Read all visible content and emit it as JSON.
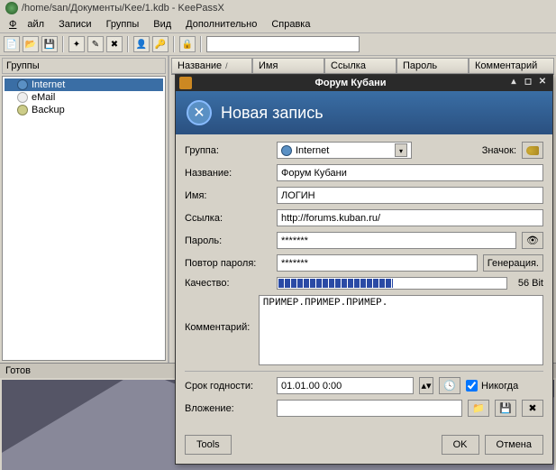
{
  "window": {
    "title": "/home/san/Документы/Kee/1.kdb - KeePassX"
  },
  "menu": {
    "file": "Файл",
    "entries": "Записи",
    "groups": "Группы",
    "view": "Вид",
    "extras": "Дополнительно",
    "help": "Справка"
  },
  "sidebar": {
    "title": "Группы",
    "items": [
      {
        "label": "Internet"
      },
      {
        "label": "eMail"
      },
      {
        "label": "Backup"
      }
    ]
  },
  "columns": {
    "title": "Название",
    "user": "Имя",
    "url": "Ссылка",
    "pwd": "Пароль",
    "comment": "Комментарий"
  },
  "status": "Готов",
  "dialog": {
    "window_title": "Форум Кубани",
    "banner": "Новая запись",
    "labels": {
      "group": "Группа:",
      "icon": "Значок:",
      "title": "Название:",
      "user": "Имя:",
      "url": "Ссылка:",
      "pwd": "Пароль:",
      "repeat": "Повтор пароля:",
      "quality": "Качество:",
      "comment": "Комментарий:",
      "expires": "Срок годности:",
      "attach": "Вложение:",
      "tools": "Tools",
      "ok": "OK",
      "cancel": "Отмена",
      "never": "Никогда",
      "gen": "Генерация."
    },
    "values": {
      "group": "Internet",
      "title": "Форум Кубани",
      "user": "ЛОГИН",
      "url": "http://forums.kuban.ru/",
      "pwd": "*******",
      "repeat": "*******",
      "quality": "56 Bit",
      "comment": "ПРИМЕР.ПРИМЕР.ПРИМЕР.",
      "expires": "01.01.00 0:00"
    }
  }
}
